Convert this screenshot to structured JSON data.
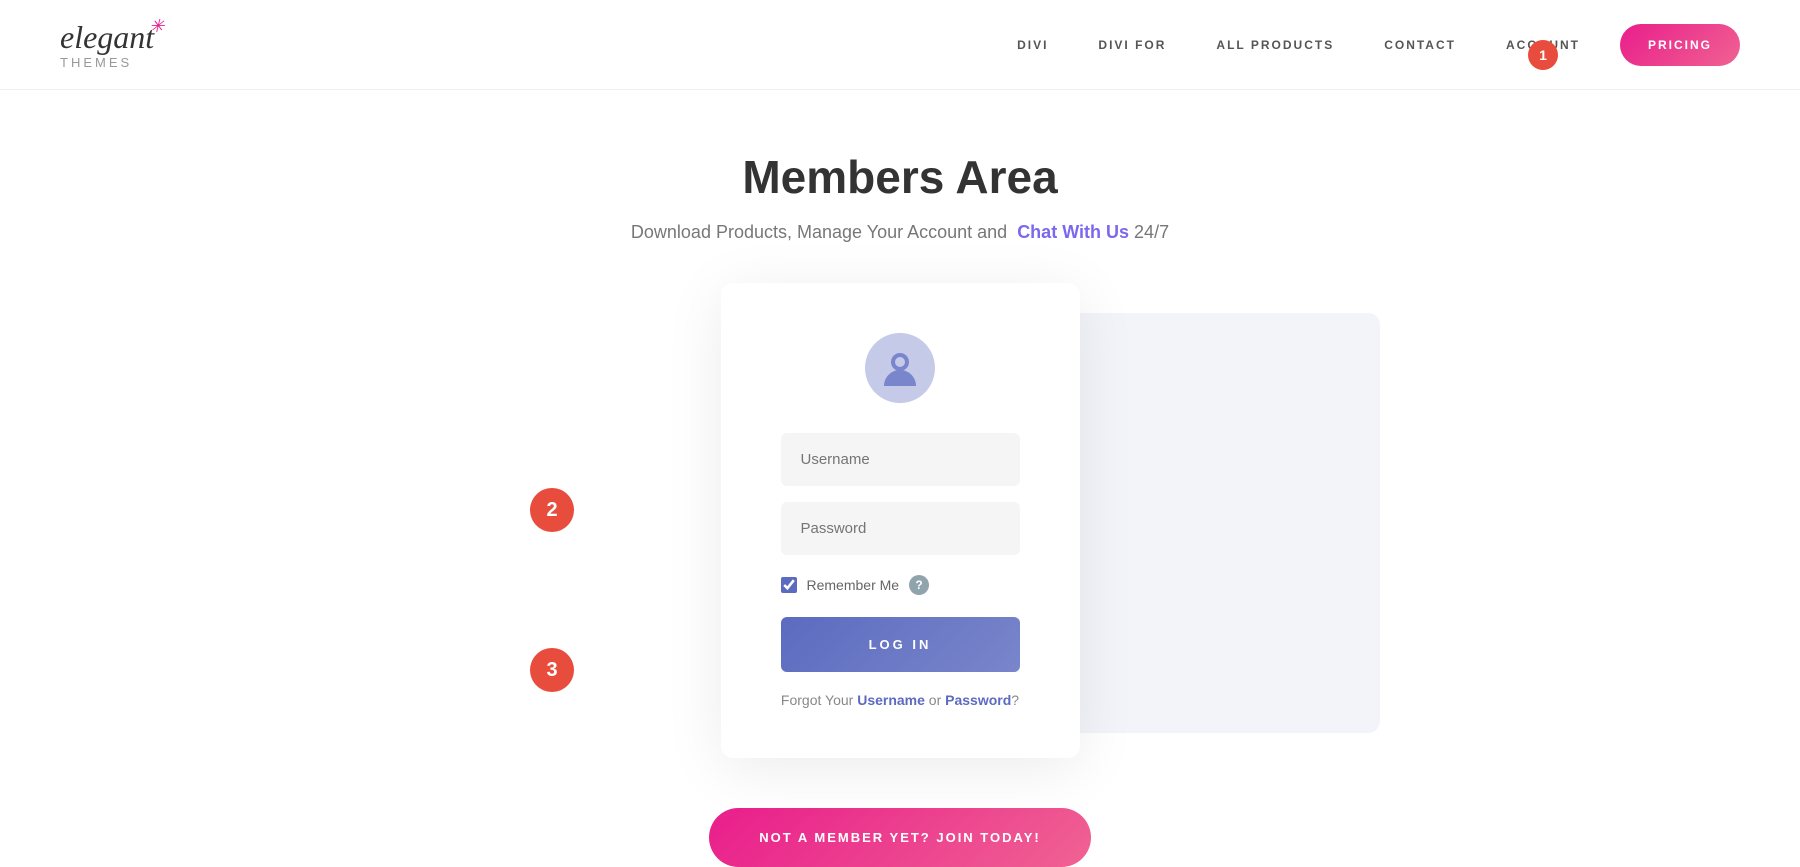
{
  "header": {
    "logo": {
      "brand": "elegant",
      "star": "✳",
      "tagline": "themes"
    },
    "nav": {
      "items": [
        {
          "label": "DIVI",
          "id": "divi"
        },
        {
          "label": "DIVI FOR",
          "id": "divi-for"
        },
        {
          "label": "ALL PRODUCTS",
          "id": "all-products"
        },
        {
          "label": "CONTACT",
          "id": "contact"
        },
        {
          "label": "ACCOUNT",
          "id": "account"
        }
      ],
      "account_badge": "1",
      "pricing_label": "PRICING"
    }
  },
  "hero": {
    "title": "Members Area",
    "subtitle_prefix": "Download Products, Manage Your Account and",
    "chat_link_text": "Chat With Us",
    "subtitle_suffix": "24/7"
  },
  "login_form": {
    "username_placeholder": "Username",
    "password_placeholder": "Password",
    "remember_me_label": "Remember Me",
    "remember_me_checked": true,
    "login_button": "LOG IN",
    "forgot_prefix": "Forgot Your",
    "forgot_username": "Username",
    "forgot_or": "or",
    "forgot_password": "Password",
    "forgot_suffix": "?"
  },
  "join_button": "NOT A MEMBER YET? JOIN TODAY!",
  "badges": {
    "badge1": "1",
    "badge2": "2",
    "badge3": "3"
  }
}
